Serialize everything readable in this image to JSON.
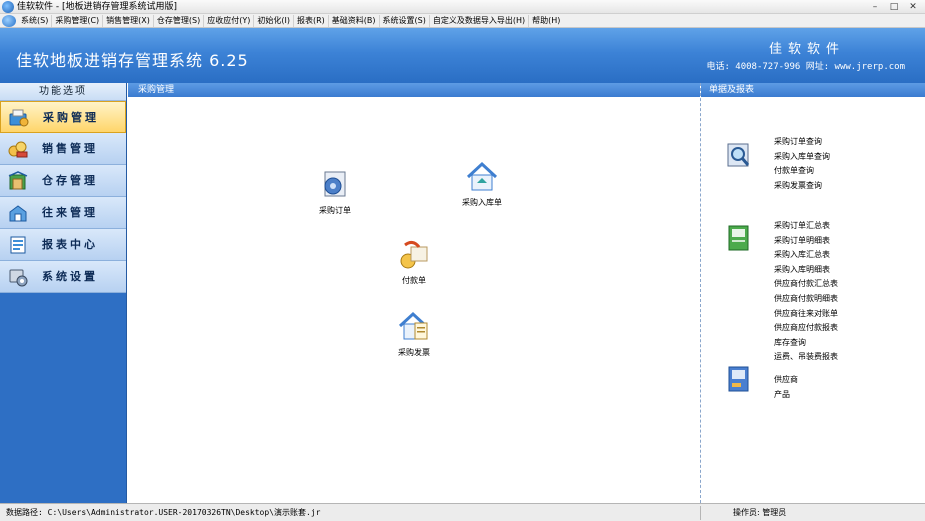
{
  "window": {
    "title": "佳软软件 - [地板进销存管理系统试用版]",
    "buttons": [
      "–",
      "□",
      "✕"
    ]
  },
  "menu": [
    "系统(S)",
    "采购管理(C)",
    "销售管理(X)",
    "仓存管理(S)",
    "应收应付(Y)",
    "初始化(I)",
    "报表(R)",
    "基础资料(B)",
    "系统设置(S)",
    "自定义及数据导入导出(H)",
    "帮助(H)"
  ],
  "banner": {
    "app_name": "佳软地板进销存管理系统 6.25",
    "company": "佳软软件",
    "contact": "电话: 4008-727-996  网址: www.jrerp.com"
  },
  "sidebar": {
    "header": "功能选项",
    "items": [
      {
        "label": "采购管理",
        "icon": "purchase-icon",
        "active": true
      },
      {
        "label": "销售管理",
        "icon": "sales-icon",
        "active": false
      },
      {
        "label": "仓存管理",
        "icon": "warehouse-icon",
        "active": false
      },
      {
        "label": "往来管理",
        "icon": "account-icon",
        "active": false
      },
      {
        "label": "报表中心",
        "icon": "report-icon",
        "active": false
      },
      {
        "label": "系统设置",
        "icon": "settings-icon",
        "active": false
      }
    ]
  },
  "main": {
    "header": "采购管理",
    "tiles": [
      {
        "label": "采购订单",
        "icon": "purchase-order-icon"
      },
      {
        "label": "采购入库单",
        "icon": "purchase-receipt-icon"
      },
      {
        "label": "付款单",
        "icon": "payment-icon"
      },
      {
        "label": "采购发票",
        "icon": "purchase-invoice-icon"
      }
    ]
  },
  "right": {
    "header": "单据及报表",
    "groups": [
      {
        "icon": "query-icon",
        "links": [
          "采购订单查询",
          "采购入库单查询",
          "付款单查询",
          "采购发票查询"
        ]
      },
      {
        "icon": "report-book-icon",
        "links": [
          "采购订单汇总表",
          "采购订单明细表",
          "采购入库汇总表",
          "采购入库明细表",
          "供应商付款汇总表",
          "供应商付款明细表",
          "供应商往来对账单",
          "供应商应付款报表",
          "库存查询",
          "运费、吊装费报表"
        ]
      },
      {
        "icon": "base-data-icon",
        "links": [
          "供应商",
          "产品"
        ]
      }
    ]
  },
  "statusbar": {
    "path": "数据路径: C:\\Users\\Administrator.USER-20170326TN\\Desktop\\演示账套.jr",
    "operator": "操作员: 管理员"
  },
  "colors": {
    "banner": "#3c82d6",
    "sidebar": "#2e6fc4",
    "active_item": "#ffd56a"
  }
}
